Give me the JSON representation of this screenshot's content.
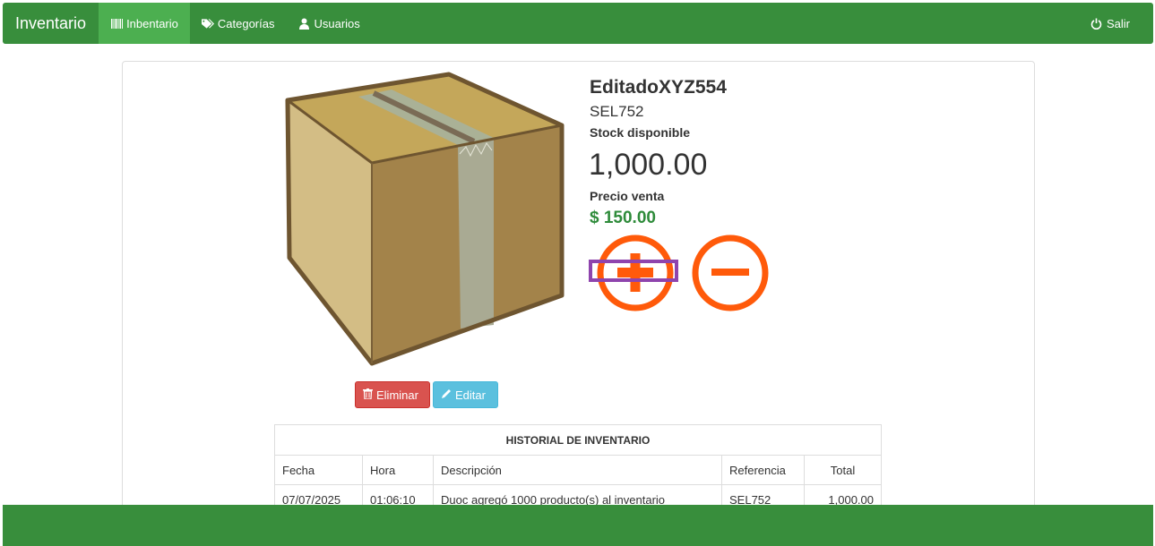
{
  "navbar": {
    "brand": "Inventario",
    "items": [
      {
        "label": "Inbentario",
        "icon": "barcode-icon",
        "active": true
      },
      {
        "label": "Categorías",
        "icon": "tags-icon",
        "active": false
      },
      {
        "label": "Usuarios",
        "icon": "user-icon",
        "active": false
      }
    ],
    "logout_label": "Salir",
    "logout_icon": "power-icon"
  },
  "product": {
    "name": "EditadoXYZ554",
    "code": "SEL752",
    "stock_label": "Stock disponible",
    "stock_value": "1,000.00",
    "price_label": "Precio venta",
    "price_value": "$ 150.00",
    "image": "cardboard-box-image"
  },
  "actions": {
    "delete_label": "Eliminar",
    "edit_label": "Editar",
    "add_icon": "plus-circle-icon",
    "remove_icon": "minus-circle-icon"
  },
  "history": {
    "title": "HISTORIAL DE INVENTARIO",
    "columns": [
      "Fecha",
      "Hora",
      "Descripción",
      "Referencia",
      "Total"
    ],
    "rows": [
      [
        "07/07/2025",
        "01:06:10",
        "Duoc agregó 1000 producto(s) al inventario",
        "SEL752",
        "1,000.00"
      ]
    ]
  },
  "colors": {
    "navbar": "#388e3c",
    "active_nav": "#4caf50",
    "accent_orange": "#ff5a0a",
    "highlight_purple": "#8e44ad",
    "price_green": "#2e8b3a",
    "danger": "#d9534f",
    "info": "#5bc0de"
  }
}
